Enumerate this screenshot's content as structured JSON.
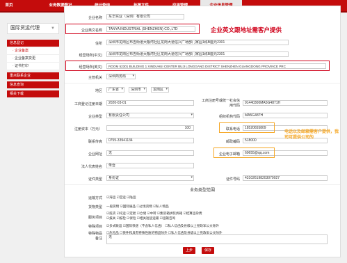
{
  "nav": [
    "首页",
    "业务数据登记",
    "统计查询",
    "年报文件",
    "应用管理",
    "企业信息管理"
  ],
  "sidebar": {
    "title": "国际货运代理",
    "items": [
      "信息登记",
      "· 企业备案",
      "· 企业备案变更",
      "· 证书打印",
      "重点联系企业",
      "信息查询",
      "相关下载"
    ]
  },
  "form": {
    "company_name_label": "企业名称",
    "company_name_value": "东华实业（深圳）有限公司",
    "company_en_label": "企业英文名称",
    "company_en_value": "TANYA INDUSTRIAL (SHENZHEN) CO.,LTD",
    "address_label": "住所",
    "address_value": "深圳市龙岗区布吉街道大靓湾社区龙岗大道信兴广场部门家园1栋B座元2301",
    "office_cn_label": "经营场所(中文)",
    "office_cn_value": "深圳市龙岗区布吉街道大靓湾社区龙岗大道信兴广场部门家园1栋B座元2301",
    "office_en_label": "经营场所(英文)",
    "office_en_value": "ROOM 52301 BUILDING 1 XINDUHUI CENTER BUJI LONGGANG DISTRICT SHENZHEN GUANGDONG PROVINCE PRC",
    "authority_label": "主管机关",
    "authority_value": "深圳商务局",
    "region_label": "地区",
    "region_province": "广东省",
    "region_city": "深圳市",
    "region_district": "龙岗区",
    "found_date_label": "工商登记注册日期",
    "found_date_value": "2020-03-01",
    "credit_code_label": "工商注册号或统一社会信用代码",
    "credit_code_value": "91440300MA5G4871H",
    "company_type_label": "企业类型",
    "company_type_value": "有限责任公司",
    "org_code_label": "组织机构代码",
    "org_code_value": "MA5G487H",
    "capital_label": "注册资本（万元）",
    "capital_value": "100",
    "phone_label": "联系电话",
    "phone_value": "18520655809",
    "fax_label": "联系传真",
    "fax_value": "0755-33941134",
    "postcode_label": "邮政编码",
    "postcode_value": "518000",
    "website_label": "企业网址",
    "website_value": "无",
    "email_label": "企业电子邮箱",
    "email_value": "60655@qq.com",
    "legal_label": "法人代表姓名",
    "legal_value": "朱吾",
    "cert_type_label": "证件类型",
    "cert_type_value": "身份证",
    "cert_no_label": "证件号码",
    "cert_no_value": "431026198203070027"
  },
  "business": {
    "section_title": "业务类型范围",
    "rows": [
      {
        "label": "运输方式",
        "opts": "☑海运 ☑空运 ☑陆运"
      },
      {
        "label": "货物类型",
        "opts": "一般货物 ☑国际展品 ☐过境货物 ☑私人物品"
      },
      {
        "label": "服务项目",
        "opts": "☑揽货 ☑托运 ☑定舱 ☑仓储 ☑中转 ☑集装箱拼装拆箱 ☑结算运杂费",
        "opts2": "☑报关 ☑报检 ☑保险 ☑相关短途运输 ☑运输咨询"
      },
      {
        "label": "特殊项目",
        "opts": "☑多式联运 ☑国际快递（不含私人信函） ☐私人信函及县级以上党政军公文除外"
      },
      {
        "label": "特殊物品",
        "opts": "☐危险品 ☐快件和具有特殊性质的物品除外 ☐私人信函及县级以上党政军公文除外"
      },
      {
        "label": "备注",
        "opts": "无"
      }
    ]
  },
  "buttons": {
    "prev": "上步",
    "save": "保存"
  },
  "annotations": {
    "en_name_note": "企业英文跟地址需客户提供",
    "contact_note": "电话以及邮箱需客户提供，我司可提供公司的"
  },
  "colors": {
    "brand_red": "#c40c0c",
    "annot_red": "#d0021b",
    "annot_orange": "#f5a623"
  }
}
